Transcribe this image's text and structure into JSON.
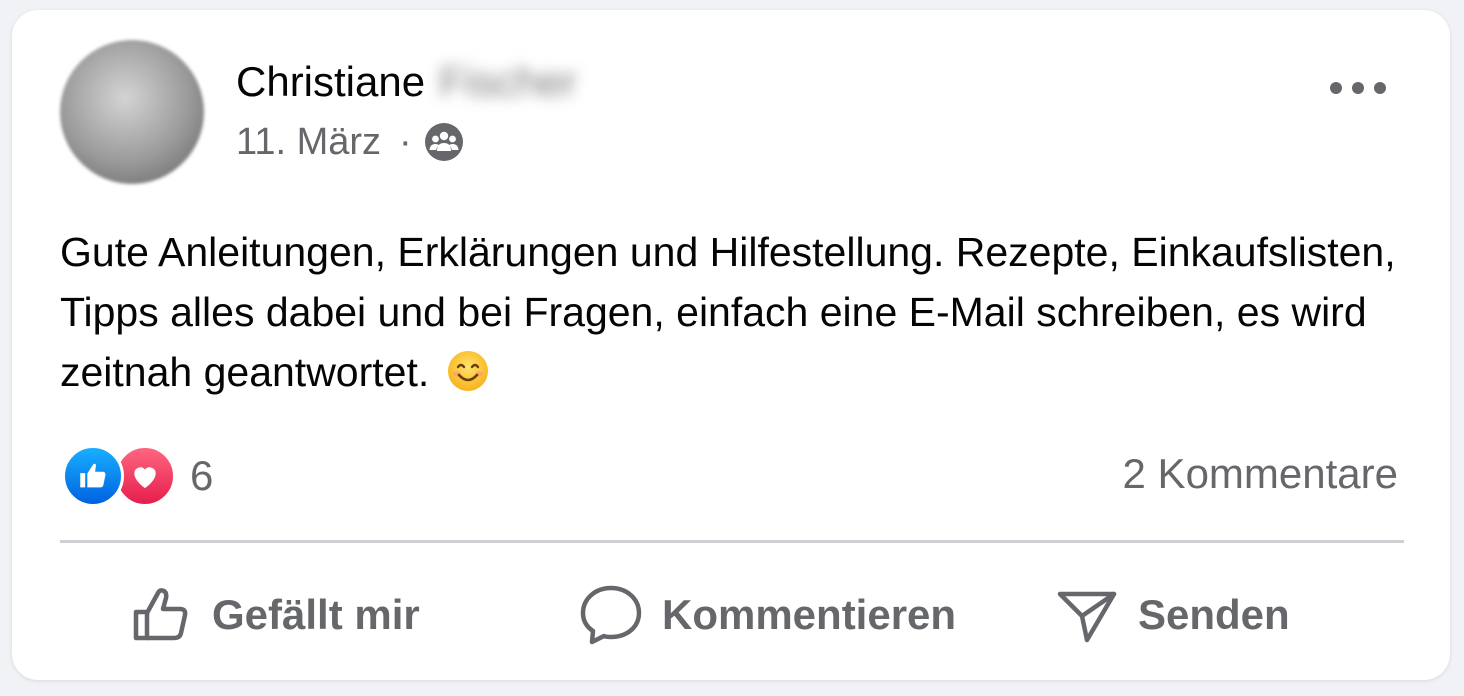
{
  "post": {
    "author_first_name": "Christiane",
    "author_last_name_blurred": "Fischer",
    "date": "11. März",
    "separator": "·",
    "audience_icon": "group-icon",
    "text": "Gute Anleitungen, Erklärungen und Hilfestellung. Rezepte, Einkaufslisten, Tipps alles dabei und bei Fragen, einfach eine E-Mail schreiben, es wird zeitnah geantwortet.",
    "emoji": "smiling-face-emoji",
    "reaction_icons": [
      "like-icon",
      "love-icon"
    ],
    "reaction_count": "6",
    "comments_label": "2 Kommentare"
  },
  "actions": {
    "like_label": "Gefällt mir",
    "comment_label": "Kommentieren",
    "send_label": "Senden"
  },
  "colors": {
    "text_primary": "#050505",
    "text_secondary": "#65676b",
    "like_blue": "#0866ff",
    "love_red": "#f33e58",
    "divider": "#ced0d4"
  }
}
